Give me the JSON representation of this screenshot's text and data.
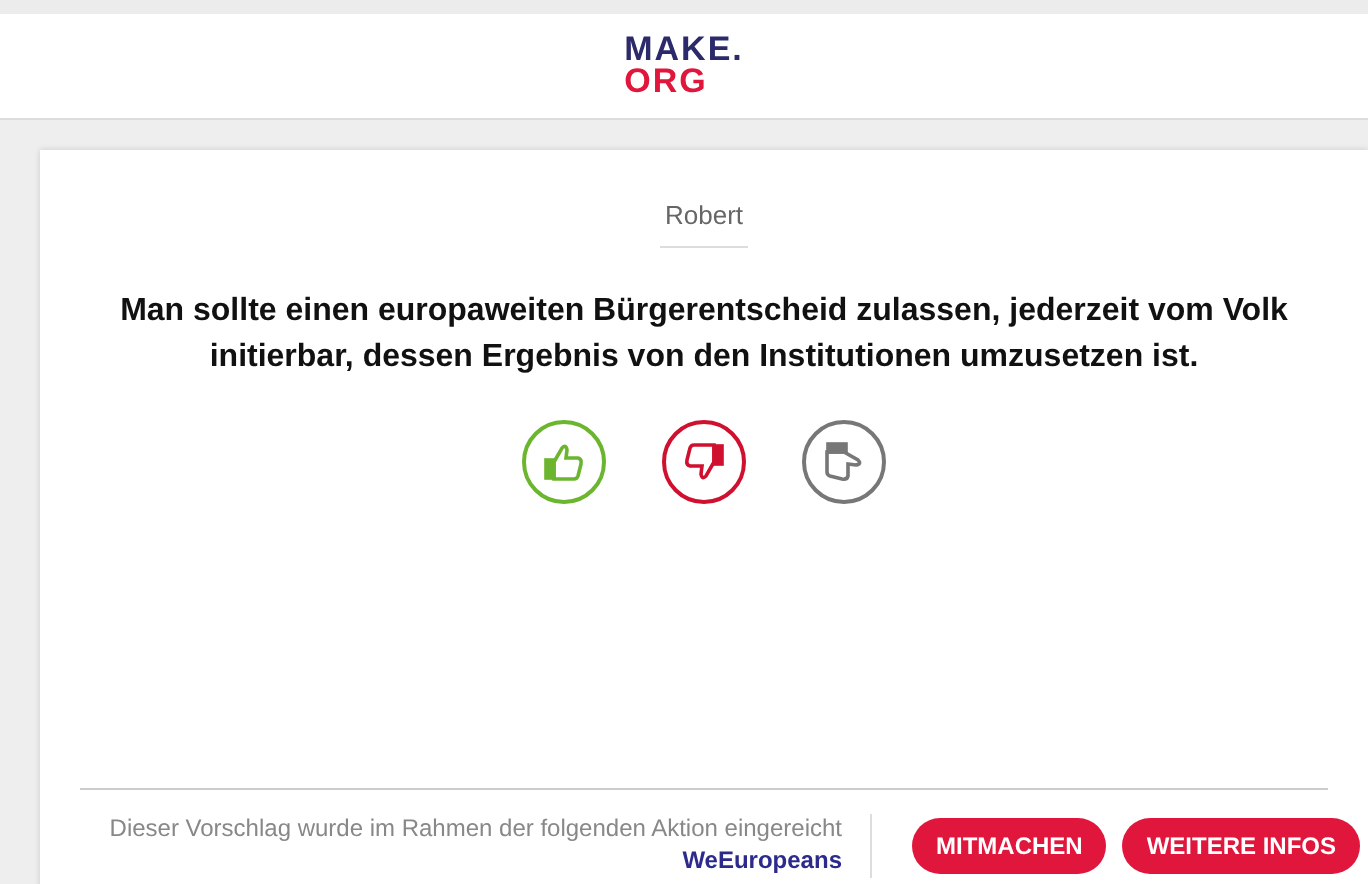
{
  "logo": {
    "line_1": "MAKE.",
    "line_2": "ORG"
  },
  "proposal": {
    "author": "Robert",
    "text": "Man sollte einen europaweiten Bürgerentscheid zulassen, jederzeit vom Volk initierbar, dessen Ergebnis von den Institutionen umzusetzen ist."
  },
  "votes": [
    {
      "kind": "agree"
    },
    {
      "kind": "disagree"
    },
    {
      "kind": "neutral"
    }
  ],
  "footer": {
    "note": "Dieser Vorschlag wurde im Rahmen der folgenden Aktion eingereicht",
    "link": "WeEuropeans",
    "buttons": [
      "MITMACHEN",
      "WEITERE INFOS"
    ]
  }
}
